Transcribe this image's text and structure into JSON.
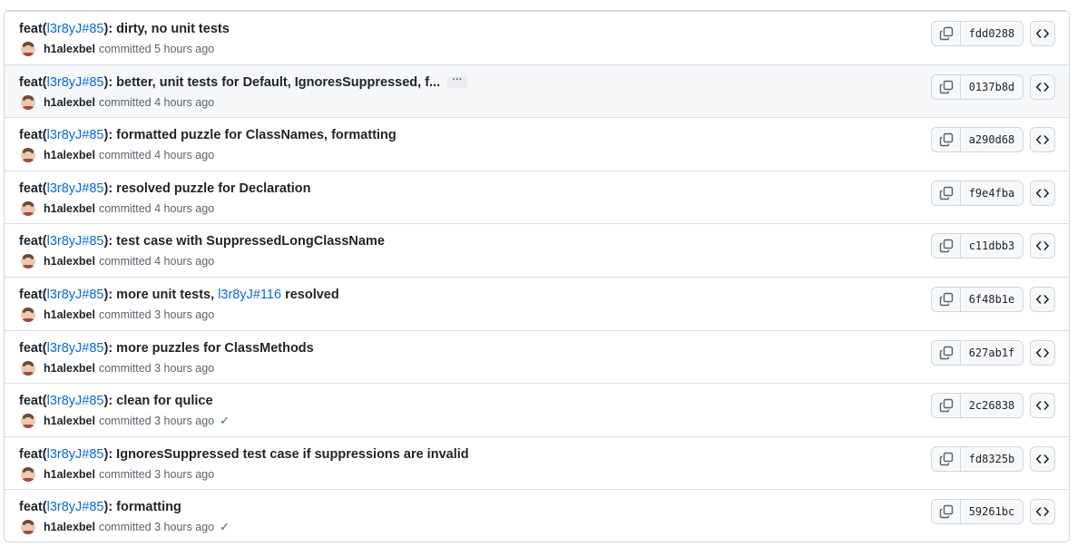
{
  "commits": [
    {
      "prefix": "feat(",
      "ref": "l3r8yJ#85",
      "message": "): dirty, no unit tests",
      "ref2": "",
      "suffix": "",
      "author": "h1alexbel",
      "committed": "committed",
      "time": "5 hours ago",
      "sha": "fdd0288",
      "check": false,
      "ellipsis": false,
      "ellipsis_label": ""
    },
    {
      "prefix": "feat(",
      "ref": "l3r8yJ#85",
      "message": "): better, unit tests for Default, IgnoresSuppressed, f...",
      "ref2": "",
      "suffix": "",
      "author": "h1alexbel",
      "committed": "committed",
      "time": "4 hours ago",
      "sha": "0137b8d",
      "check": false,
      "ellipsis": true,
      "ellipsis_label": "···"
    },
    {
      "prefix": "feat(",
      "ref": "l3r8yJ#85",
      "message": "): formatted puzzle for ClassNames, formatting",
      "ref2": "",
      "suffix": "",
      "author": "h1alexbel",
      "committed": "committed",
      "time": "4 hours ago",
      "sha": "a290d68",
      "check": false,
      "ellipsis": false,
      "ellipsis_label": ""
    },
    {
      "prefix": "feat(",
      "ref": "l3r8yJ#85",
      "message": "): resolved puzzle for Declaration",
      "ref2": "",
      "suffix": "",
      "author": "h1alexbel",
      "committed": "committed",
      "time": "4 hours ago",
      "sha": "f9e4fba",
      "check": false,
      "ellipsis": false,
      "ellipsis_label": ""
    },
    {
      "prefix": "feat(",
      "ref": "l3r8yJ#85",
      "message": "): test case with SuppressedLongClassName",
      "ref2": "",
      "suffix": "",
      "author": "h1alexbel",
      "committed": "committed",
      "time": "4 hours ago",
      "sha": "c11dbb3",
      "check": false,
      "ellipsis": false,
      "ellipsis_label": ""
    },
    {
      "prefix": "feat(",
      "ref": "l3r8yJ#85",
      "message": "): more unit tests, ",
      "ref2": "l3r8yJ#116",
      "suffix": " resolved",
      "author": "h1alexbel",
      "committed": "committed",
      "time": "3 hours ago",
      "sha": "6f48b1e",
      "check": false,
      "ellipsis": false,
      "ellipsis_label": ""
    },
    {
      "prefix": "feat(",
      "ref": "l3r8yJ#85",
      "message": "): more puzzles for ClassMethods",
      "ref2": "",
      "suffix": "",
      "author": "h1alexbel",
      "committed": "committed",
      "time": "3 hours ago",
      "sha": "627ab1f",
      "check": false,
      "ellipsis": false,
      "ellipsis_label": ""
    },
    {
      "prefix": "feat(",
      "ref": "l3r8yJ#85",
      "message": "): clean for qulice",
      "ref2": "",
      "suffix": "",
      "author": "h1alexbel",
      "committed": "committed",
      "time": "3 hours ago",
      "sha": "2c26838",
      "check": true,
      "ellipsis": false,
      "ellipsis_label": ""
    },
    {
      "prefix": "feat(",
      "ref": "l3r8yJ#85",
      "message": "): IgnoresSuppressed test case if suppressions are invalid",
      "ref2": "",
      "suffix": "",
      "author": "h1alexbel",
      "committed": "committed",
      "time": "3 hours ago",
      "sha": "fd8325b",
      "check": false,
      "ellipsis": false,
      "ellipsis_label": ""
    },
    {
      "prefix": "feat(",
      "ref": "l3r8yJ#85",
      "message": "): formatting",
      "ref2": "",
      "suffix": "",
      "author": "h1alexbel",
      "committed": "committed",
      "time": "3 hours ago",
      "sha": "59261bc",
      "check": true,
      "ellipsis": false,
      "ellipsis_label": ""
    }
  ],
  "icons": {
    "copy": "copy-icon",
    "code": "code-icon",
    "check": "check-icon"
  },
  "colors": {
    "link": "#0969da",
    "success": "#1a7f37",
    "border": "#d0d7de",
    "hover_row": "#f6f8fa"
  }
}
